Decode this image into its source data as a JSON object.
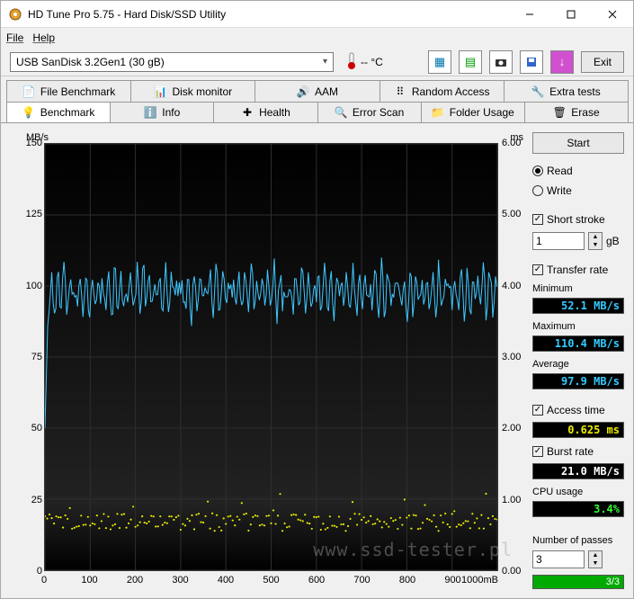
{
  "window": {
    "title": "HD Tune Pro 5.75 - Hard Disk/SSD Utility"
  },
  "menu": {
    "file": "File",
    "help": "Help"
  },
  "toolbar": {
    "device": "USB SanDisk 3.2Gen1 (30 gB)",
    "temp": "-- °C",
    "exit": "Exit"
  },
  "tabs_top": {
    "file_bench": "File Benchmark",
    "disk_mon": "Disk monitor",
    "aam": "AAM",
    "random": "Random Access",
    "extra": "Extra tests"
  },
  "tabs_bottom": {
    "benchmark": "Benchmark",
    "info": "Info",
    "health": "Health",
    "error": "Error Scan",
    "folder": "Folder Usage",
    "erase": "Erase"
  },
  "chart": {
    "yunit_left": "MB/s",
    "yunit_right": "ms",
    "xunit": "mB"
  },
  "chart_data": {
    "type": "line",
    "title": "",
    "xlabel": "mB",
    "ylim_left": [
      0,
      150
    ],
    "ylim_right": [
      0,
      6.0
    ],
    "xlim": [
      0,
      1000
    ],
    "xticks": [
      0,
      100,
      200,
      300,
      400,
      500,
      600,
      700,
      800,
      900,
      1000
    ],
    "yticks_left": [
      0,
      25,
      50,
      75,
      100,
      125,
      150
    ],
    "yticks_right": [
      "0.00",
      "1.00",
      "2.00",
      "3.00",
      "4.00",
      "5.00",
      "6.00"
    ],
    "series": [
      {
        "name": "Transfer rate (MB/s)",
        "color": "#3fc7ff",
        "axis": "left",
        "x": [
          0,
          10,
          20,
          30,
          40,
          50,
          60,
          70,
          80,
          90,
          100,
          120,
          140,
          160,
          180,
          200,
          220,
          240,
          260,
          280,
          300,
          320,
          340,
          360,
          380,
          400,
          420,
          440,
          460,
          480,
          500,
          520,
          540,
          560,
          580,
          600,
          620,
          640,
          660,
          680,
          700,
          720,
          740,
          760,
          780,
          800,
          820,
          840,
          860,
          880,
          900,
          920,
          940,
          960,
          980,
          1000
        ],
        "y": [
          50,
          100,
          97,
          103,
          95,
          101,
          98,
          104,
          96,
          100,
          99,
          102,
          96,
          105,
          97,
          101,
          99,
          103,
          95,
          100,
          98,
          104,
          96,
          101,
          99,
          102,
          97,
          103,
          95,
          100,
          98,
          104,
          96,
          101,
          99,
          102,
          97,
          103,
          95,
          100,
          98,
          104,
          96,
          101,
          99,
          102,
          97,
          103,
          98,
          101,
          97,
          102,
          99,
          104,
          96,
          100
        ]
      },
      {
        "name": "Access time (ms)",
        "color": "#eeee00",
        "axis": "right",
        "x": [
          0,
          50,
          100,
          150,
          200,
          250,
          300,
          350,
          400,
          450,
          500,
          550,
          600,
          650,
          700,
          750,
          800,
          850,
          900,
          950,
          1000
        ],
        "y": [
          0.7,
          0.55,
          0.68,
          0.58,
          0.72,
          0.6,
          0.66,
          0.55,
          0.7,
          0.62,
          0.58,
          0.65,
          0.6,
          0.57,
          0.68,
          0.62,
          0.55,
          0.7,
          0.6,
          0.58,
          0.63
        ]
      }
    ]
  },
  "side": {
    "start": "Start",
    "read": "Read",
    "write": "Write",
    "short_stroke": "Short stroke",
    "short_stroke_val": "1",
    "gb": "gB",
    "transfer_rate": "Transfer rate",
    "minimum": "Minimum",
    "minimum_val": "52.1 MB/s",
    "maximum": "Maximum",
    "maximum_val": "110.4 MB/s",
    "average": "Average",
    "average_val": "97.9 MB/s",
    "access_time": "Access time",
    "access_time_val": "0.625 ms",
    "burst_rate": "Burst rate",
    "burst_rate_val": "21.0 MB/s",
    "cpu_usage": "CPU usage",
    "cpu_usage_val": "3.4%",
    "passes": "Number of passes",
    "passes_val": "3",
    "progress": "3/3"
  },
  "watermark": "www.ssd-tester.pl"
}
